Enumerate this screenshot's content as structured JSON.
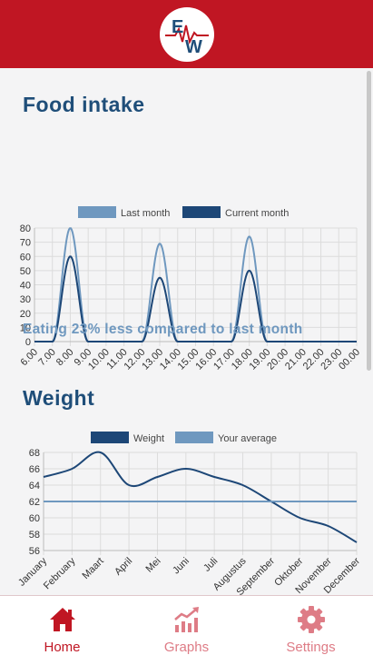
{
  "app": {
    "logo_text": "EW"
  },
  "food": {
    "title": "Food intake",
    "summary": "Eating 23% less compared to last month",
    "chart_data": {
      "type": "line",
      "categories": [
        "6.00",
        "7.00",
        "8.00",
        "9.00",
        "10.00",
        "11.00",
        "12.00",
        "13.00",
        "14.00",
        "15.00",
        "16.00",
        "17.00",
        "18.00",
        "19.00",
        "20.00",
        "21.00",
        "22.00",
        "23.00",
        "00.00"
      ],
      "series": [
        {
          "name": "Last month",
          "color": "#6f98bf",
          "peaks": [
            {
              "x": 8.0,
              "y": 80
            },
            {
              "x": 13.0,
              "y": 69
            },
            {
              "x": 18.0,
              "y": 74
            }
          ]
        },
        {
          "name": "Current month",
          "color": "#1d4777",
          "peaks": [
            {
              "x": 8.0,
              "y": 60
            },
            {
              "x": 13.0,
              "y": 45
            },
            {
              "x": 18.0,
              "y": 50
            }
          ]
        }
      ],
      "ylim": [
        0,
        80
      ],
      "yticks": [
        0,
        10,
        20,
        30,
        40,
        50,
        60,
        70,
        80
      ],
      "grid": true,
      "legend": "top"
    }
  },
  "weight": {
    "title": "Weight",
    "chart_data": {
      "type": "line",
      "categories": [
        "January",
        "February",
        "Maart",
        "April",
        "Mei",
        "Juni",
        "Juli",
        "Augustus",
        "September",
        "Oktober",
        "November",
        "December"
      ],
      "series": [
        {
          "name": "Weight",
          "color": "#1d4777",
          "values": [
            65,
            66,
            68,
            64,
            65,
            66,
            65,
            64,
            62,
            60,
            59,
            57
          ]
        },
        {
          "name": "Your average",
          "color": "#6f98bf",
          "values": [
            62,
            62,
            62,
            62,
            62,
            62,
            62,
            62,
            62,
            62,
            62,
            62
          ]
        }
      ],
      "ylim": [
        56,
        68
      ],
      "yticks": [
        56,
        58,
        60,
        62,
        64,
        66,
        68
      ],
      "grid": true,
      "legend": "top"
    }
  },
  "nav": {
    "items": [
      {
        "label": "Home",
        "icon": "home-icon"
      },
      {
        "label": "Graphs",
        "icon": "graphs-icon"
      },
      {
        "label": "Settings",
        "icon": "gear-icon"
      }
    ]
  },
  "colors": {
    "brand": "#c01623",
    "text_dark": "#1f4e79",
    "accent_light": "#6f98bf"
  }
}
